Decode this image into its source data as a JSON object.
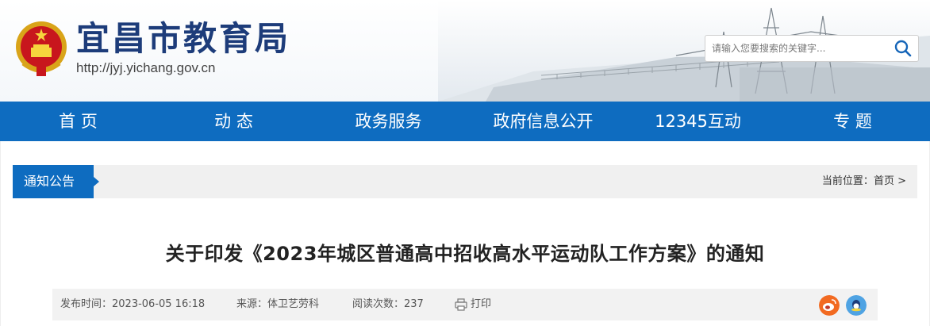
{
  "header": {
    "site_name": "宜昌市教育局",
    "site_url": "http://jyj.yichang.gov.cn",
    "search": {
      "placeholder": "请输入您要搜索的关键字..."
    }
  },
  "nav": {
    "items": [
      "首 页",
      "动 态",
      "政务服务",
      "政府信息公开",
      "12345互动",
      "专 题"
    ]
  },
  "breadcrumb": {
    "section": "通知公告",
    "location_label": "当前位置：",
    "home": "首页",
    "separator": ">"
  },
  "article": {
    "title": "关于印发《2023年城区普通高中招收高水平运动队工作方案》的通知",
    "publish_time": "发布时间：2023-06-05 16:18",
    "source": "来源：体卫艺劳科",
    "views": "阅读次数：237",
    "print_label": "打印"
  },
  "colors": {
    "nav_bg": "#0e6cc0",
    "title_text": "#1d3c7a",
    "weibo": "#f26a21",
    "qq": "#4fa3e3"
  }
}
